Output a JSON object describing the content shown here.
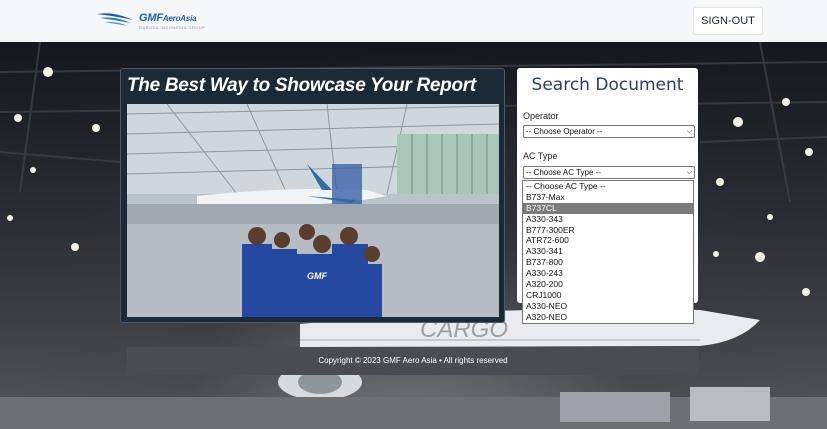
{
  "header": {
    "logo_main": "GMF",
    "logo_suffix": "AeroAsia",
    "logo_sub": "GARUDA INDONESIA GROUP",
    "signout_label": "SIGN-OUT"
  },
  "showcase": {
    "title": "The Best Way to Showcase Your Report",
    "photo_badge": "GMF"
  },
  "background": {
    "cargo_text": "CARGO"
  },
  "search": {
    "title": "Search Document",
    "operator_label": "Operator",
    "operator_value": "-- Choose Operator --",
    "actype_label": "AC Type",
    "actype_value": "-- Choose AC Type --",
    "actype_options": [
      "-- Choose AC Type --",
      "B737-Max",
      "B737CL",
      "A330-343",
      "B777-300ER",
      "ATR72-600",
      "A330-341",
      "B737-800",
      "A330-243",
      "A320-200",
      "CRJ1000",
      "A330-NEO",
      "A320-NEO"
    ],
    "highlighted_option": "B737CL"
  },
  "footer": {
    "copyright": "Copyright © 2023 GMF Aero Asia • All rights reserved"
  },
  "colors": {
    "brand_blue": "#1d5fa8",
    "title_navy": "#2b3e5c",
    "footer_bg": "#4b4c52",
    "highlight_gray": "#7b7b7b"
  }
}
